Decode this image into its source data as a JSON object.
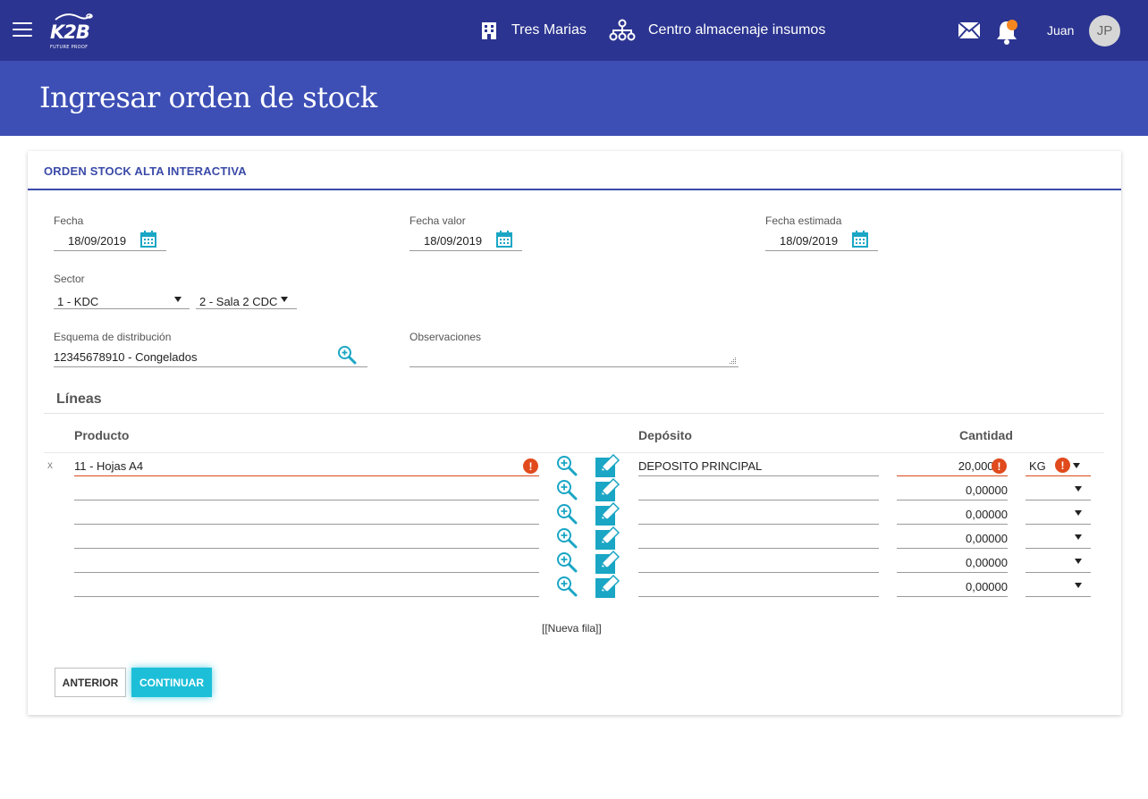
{
  "header": {
    "logo": {
      "text": "K2B",
      "tagline": "FUTURE PROOF"
    },
    "company": "Tres Marias",
    "location": "Centro almacenaje insumos",
    "user_name": "Juan",
    "user_initials": "JP",
    "notification_dot_color": "#f5871f"
  },
  "page": {
    "title": "Ingresar orden de stock"
  },
  "card": {
    "title": "ORDEN STOCK ALTA INTERACTIVA"
  },
  "form": {
    "fecha": {
      "label": "Fecha",
      "value": "18/09/2019"
    },
    "fecha_valor": {
      "label": "Fecha valor",
      "value": "18/09/2019"
    },
    "fecha_estimada": {
      "label": "Fecha estimada",
      "value": "18/09/2019"
    },
    "sector": {
      "label": "Sector",
      "value1": "1 - KDC",
      "value2": "2 - Sala 2 CDC"
    },
    "esquema": {
      "label": "Esquema de distribución",
      "value": "12345678910 - Congelados"
    },
    "observaciones": {
      "label": "Observaciones",
      "value": ""
    }
  },
  "lineas": {
    "title": "Líneas",
    "columns": {
      "producto": "Producto",
      "deposito": "Depósito",
      "cantidad": "Cantidad"
    },
    "remove_label": "x",
    "rows": [
      {
        "producto": "11 - Hojas A4",
        "deposito": "DEPOSITO PRINCIPAL",
        "cantidad": "20,00000",
        "unidad": "KG"
      },
      {
        "producto": "",
        "deposito": "",
        "cantidad": "0,00000",
        "unidad": ""
      },
      {
        "producto": "",
        "deposito": "",
        "cantidad": "0,00000",
        "unidad": ""
      },
      {
        "producto": "",
        "deposito": "",
        "cantidad": "0,00000",
        "unidad": ""
      },
      {
        "producto": "",
        "deposito": "",
        "cantidad": "0,00000",
        "unidad": ""
      },
      {
        "producto": "",
        "deposito": "",
        "cantidad": "0,00000",
        "unidad": ""
      }
    ],
    "new_row_label": "[[Nueva fila]]"
  },
  "buttons": {
    "prev": "ANTERIOR",
    "next": "CONTINUAR"
  },
  "colors": {
    "topbar": "#2b3490",
    "titlebar": "#3d4fb5",
    "accent": "#3a4aa8",
    "primary_button": "#1dbfd8",
    "error": "#e04a1c",
    "icon_teal": "#1aa6c4"
  }
}
